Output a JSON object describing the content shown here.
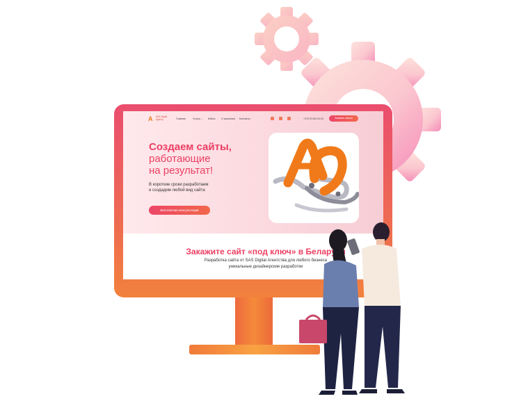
{
  "site": {
    "logo": {
      "mark": "A",
      "name": "SAS Digital Agency"
    },
    "nav": [
      {
        "label": "Главная"
      },
      {
        "label": "Услуги ⌄"
      },
      {
        "label": "Кейсы"
      },
      {
        "label": "О компании"
      },
      {
        "label": "Контакты"
      }
    ],
    "phone": "+375 29 000-00-00",
    "header_button": "Заказать звонок",
    "hero": {
      "title_line1": "Создаем сайты,",
      "title_line2": "работающие",
      "title_line3": "на результат!",
      "subtitle_line1": "В короткие сроки разработаем",
      "subtitle_line2": "и создадим любой вид сайта",
      "button": "Бесплатная консультация"
    },
    "section": {
      "title": "Закажите сайт «под ключ» в Беларуси",
      "line1": "Разработка сайта от SAS Digital Агентства для любого бизнеса",
      "line2": "уникальные дизайнерские разработки"
    }
  },
  "colors": {
    "accent": "#ec3f63",
    "orange": "#f2813d",
    "gear_light": "#fbd3cf",
    "gear_pink": "#f7a5c6"
  },
  "icons": [
    "gear-icon",
    "social-icon",
    "robot-hand-illustration",
    "people-illustration"
  ]
}
